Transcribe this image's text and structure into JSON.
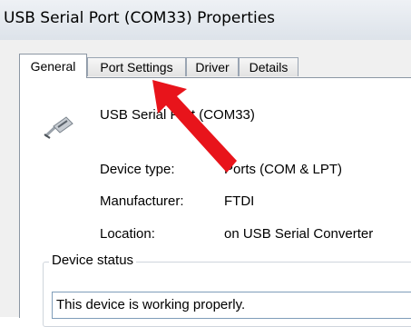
{
  "window": {
    "title": "USB Serial Port (COM33) Properties"
  },
  "tabs": [
    {
      "label": "General",
      "active": true
    },
    {
      "label": "Port Settings",
      "active": false
    },
    {
      "label": "Driver",
      "active": false
    },
    {
      "label": "Details",
      "active": false
    }
  ],
  "device": {
    "name": "USB Serial Port (COM33)",
    "icon": "usb-plug-icon",
    "properties": [
      {
        "label": "Device type:",
        "value": "Ports (COM & LPT)"
      },
      {
        "label": "Manufacturer:",
        "value": "FTDI"
      },
      {
        "label": "Location:",
        "value": "on USB Serial Converter"
      }
    ]
  },
  "status": {
    "legend": "Device status",
    "text": "This device is working properly."
  },
  "annotation": {
    "icon": "red-arrow-icon",
    "color": "#e8141b"
  },
  "colors": {
    "tab_border": "#8c97a4",
    "status_border": "#7f9db9"
  }
}
